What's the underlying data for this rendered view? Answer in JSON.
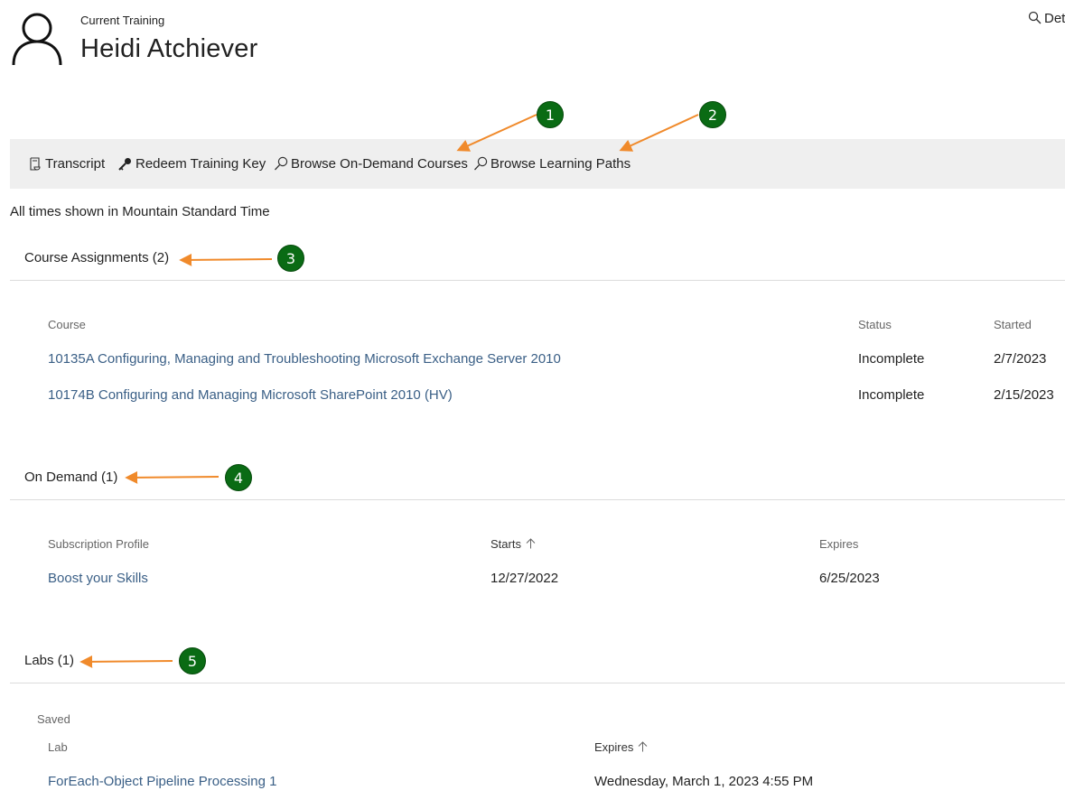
{
  "header": {
    "subtitle": "Current Training",
    "title": "Heidi Atchiever",
    "top_right_label": "Det"
  },
  "toolbar": {
    "transcript": "Transcript",
    "redeem": "Redeem Training Key",
    "browse_courses": "Browse On-Demand Courses",
    "browse_paths": "Browse Learning Paths"
  },
  "timezone_note": "All times shown in Mountain Standard Time",
  "course_assignments": {
    "title": "Course Assignments (2)",
    "columns": [
      "Course",
      "Status",
      "Started"
    ],
    "rows": [
      {
        "course": "10135A Configuring, Managing and Troubleshooting Microsoft Exchange Server 2010",
        "status": "Incomplete",
        "started": "2/7/2023"
      },
      {
        "course": "10174B Configuring and Managing Microsoft SharePoint 2010 (HV)",
        "status": "Incomplete",
        "started": "2/15/2023"
      }
    ]
  },
  "on_demand": {
    "title": "On Demand (1)",
    "columns": [
      "Subscription Profile",
      "Starts",
      "Expires"
    ],
    "rows": [
      {
        "profile": "Boost your Skills",
        "starts": "12/27/2022",
        "expires": "6/25/2023"
      }
    ]
  },
  "labs": {
    "title": "Labs (1)",
    "group_label": "Saved",
    "columns": [
      "Lab",
      "Expires"
    ],
    "rows": [
      {
        "lab": "ForEach-Object Pipeline Processing 1",
        "expires": "Wednesday, March 1, 2023 4:55 PM"
      }
    ]
  },
  "annotations": {
    "badges": [
      "1",
      "2",
      "3",
      "4",
      "5"
    ],
    "badge_color": "#0a6b14",
    "arrow_color": "#f08a2b"
  },
  "colors": {
    "link": "#3a5f86",
    "toolbar_bg": "#efefef"
  }
}
